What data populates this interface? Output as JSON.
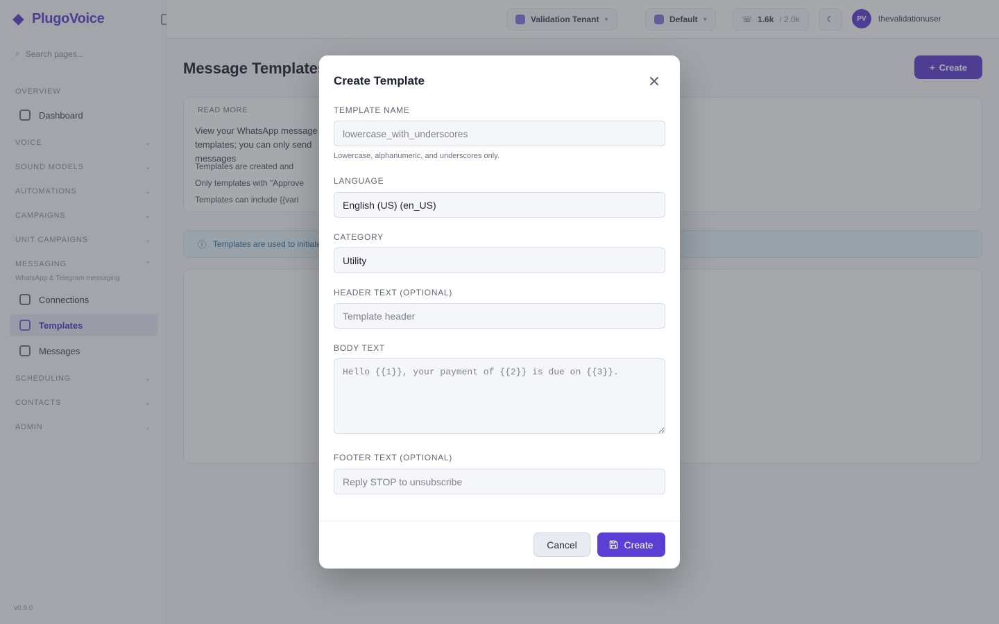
{
  "app": {
    "logo_text": "PlugoVoice",
    "search_label": "Search pages...",
    "version": "v0.9.0"
  },
  "sidebar": {
    "groups": [
      {
        "label": "Overview"
      },
      {
        "label": "Voice"
      },
      {
        "label": "Sound Models"
      },
      {
        "label": "Automations"
      },
      {
        "label": "Campaigns"
      },
      {
        "label": "Unit Campaigns"
      },
      {
        "label": "Messaging"
      },
      {
        "label": "Scheduling"
      },
      {
        "label": "Contacts"
      },
      {
        "label": "Admin"
      }
    ],
    "dashboard_label": "Dashboard",
    "messaging_sub": "WhatsApp & Telegram messaging",
    "items": [
      {
        "label": "Connections"
      },
      {
        "label": "Templates"
      },
      {
        "label": "Messages"
      }
    ]
  },
  "topbar": {
    "tenant": "Validation Tenant",
    "workspace": "Default",
    "credits": "1.6k",
    "credits_sub": "/ 2.0k",
    "avatar_initials": "PV",
    "user_name": "thevalidationuser"
  },
  "page": {
    "title": "Message Templates",
    "create_label": "Create",
    "info_header": "Read more",
    "info_text": "View your WhatsApp message templates; you can only send messages",
    "info_items": [
      "Templates are created and",
      "Only templates with \"Approve",
      "Templates can include {{vari"
    ],
    "banner_text": "Templates are used to initiate conversations outside the 24-hour window. Approval typically takes minutes before sending."
  },
  "modal": {
    "title": "Create Template",
    "template_name": {
      "label": "Template Name",
      "placeholder": "lowercase_with_underscores",
      "hint": "Lowercase, alphanumeric, and underscores only."
    },
    "language": {
      "label": "Language",
      "value": "English (US) (en_US)"
    },
    "category": {
      "label": "Category",
      "value": "Utility"
    },
    "header_text": {
      "label": "Header Text (Optional)",
      "placeholder": "Template header"
    },
    "body_text": {
      "label": "Body Text",
      "placeholder": "Hello {{1}}, your payment of {{2}} is due on {{3}}."
    },
    "footer_text": {
      "label": "Footer Text (Optional)",
      "placeholder": "Reply STOP to unsubscribe"
    },
    "cancel_label": "Cancel",
    "create_label": "Create"
  },
  "colors": {
    "accent": "#5b3fd4",
    "overlay": "rgba(60,62,72,0.45)"
  }
}
